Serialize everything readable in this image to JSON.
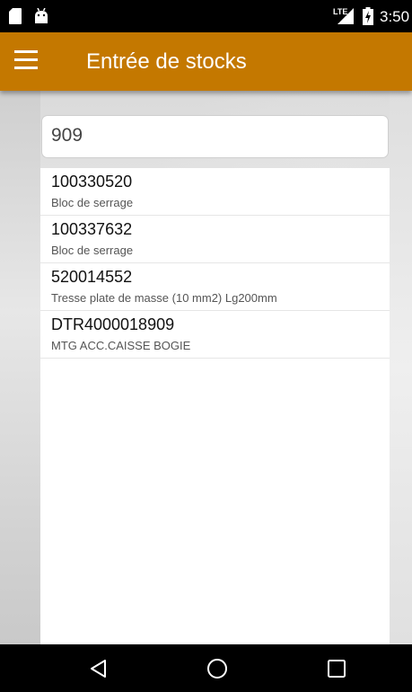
{
  "status_bar": {
    "network_label": "LTE",
    "time": "3:50"
  },
  "app_bar": {
    "title": "Entrée de stocks",
    "menu_icon": "hamburger-menu-icon",
    "color": "#c47800"
  },
  "search": {
    "value": "909"
  },
  "results": [
    {
      "code": "100330520",
      "description": "Bloc de serrage"
    },
    {
      "code": "100337632",
      "description": "Bloc de serrage"
    },
    {
      "code": "520014552",
      "description": "Tresse plate de masse (10 mm2) Lg200mm"
    },
    {
      "code": "DTR4000018909",
      "description": "MTG ACC.CAISSE BOGIE"
    }
  ],
  "nav_bar": {
    "back_icon": "back-triangle-icon",
    "home_icon": "home-circle-icon",
    "recents_icon": "recents-square-icon"
  }
}
